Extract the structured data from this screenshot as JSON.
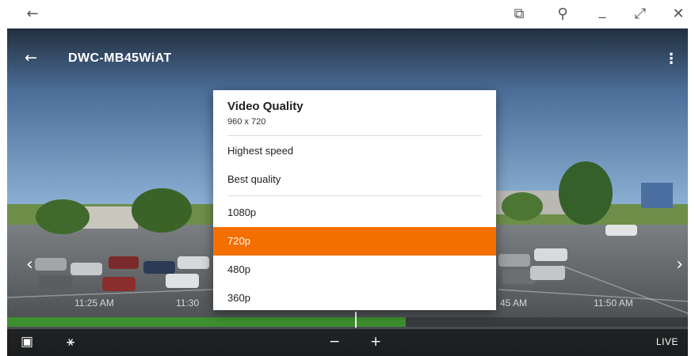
{
  "window": {
    "back_glyph": "←",
    "controls": [
      {
        "name": "picture-in-picture-icon",
        "glyph": "⧉"
      },
      {
        "name": "pin-icon",
        "glyph": "⚲"
      },
      {
        "name": "minimize-icon",
        "glyph": "_"
      },
      {
        "name": "expand-icon",
        "glyph": "⤢"
      },
      {
        "name": "close-icon",
        "glyph": "✕"
      }
    ]
  },
  "camera": {
    "title": "DWC-MB45WiAT",
    "back_glyph": "←",
    "more_glyph": "⋮",
    "prev_glyph": "‹",
    "next_glyph": "›"
  },
  "timeline": {
    "labels": [
      "11:25 AM",
      "11:30",
      "45 AM",
      "11:50 AM"
    ],
    "recorded_fraction": 0.585,
    "recorded_color": "#3e8f2f"
  },
  "toolbar": {
    "calendar_glyph": "▣",
    "motion_glyph": "⚹",
    "zoom_out_glyph": "−",
    "zoom_in_glyph": "+",
    "live_label": "LIVE"
  },
  "quality_menu": {
    "title": "Video Quality",
    "current_resolution": "960 x 720",
    "modes": [
      "Highest speed",
      "Best quality"
    ],
    "resolutions": [
      "1080p",
      "720p",
      "480p",
      "360p"
    ],
    "selected": "720p",
    "accent_color": "#f56e00"
  }
}
